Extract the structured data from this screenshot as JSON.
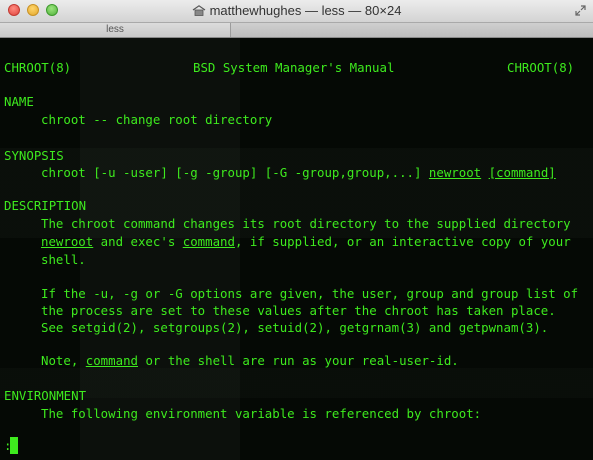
{
  "window": {
    "title": "matthewhughes — less — 80×24",
    "tab_label": "less"
  },
  "header": {
    "left": "CHROOT(8)",
    "center": "BSD System Manager's Manual",
    "right": "CHROOT(8)"
  },
  "name": {
    "heading": "NAME",
    "text": "chroot -- change root directory"
  },
  "synopsis": {
    "heading": "SYNOPSIS",
    "prefix": "chroot [-u -user] [-g -group] [-G -group,group,...] ",
    "arg1": "newroot",
    "sep": " ",
    "arg2": "[command]"
  },
  "description": {
    "heading": "DESCRIPTION",
    "line1": "The chroot command changes its root directory to the supplied directory",
    "line2_a": "newroot",
    "line2_b": " and exec's ",
    "line2_c": "command",
    "line2_d": ", if supplied, or an interactive copy of your",
    "line3": "shell.",
    "line4": "If the -u, -g or -G options are given, the user, group and group list of",
    "line5": "the process are set to these values after the chroot has taken place.",
    "line6": "See setgid(2), setgroups(2), setuid(2), getgrnam(3) and getpwnam(3).",
    "line7_a": "Note, ",
    "line7_b": "command",
    "line7_c": " or the shell are run as your real-user-id."
  },
  "environment": {
    "heading": "ENVIRONMENT",
    "text": "The following environment variable is referenced by chroot:"
  },
  "prompt": ":",
  "colors": {
    "text": "#3eeb1e",
    "background": "#050905"
  }
}
